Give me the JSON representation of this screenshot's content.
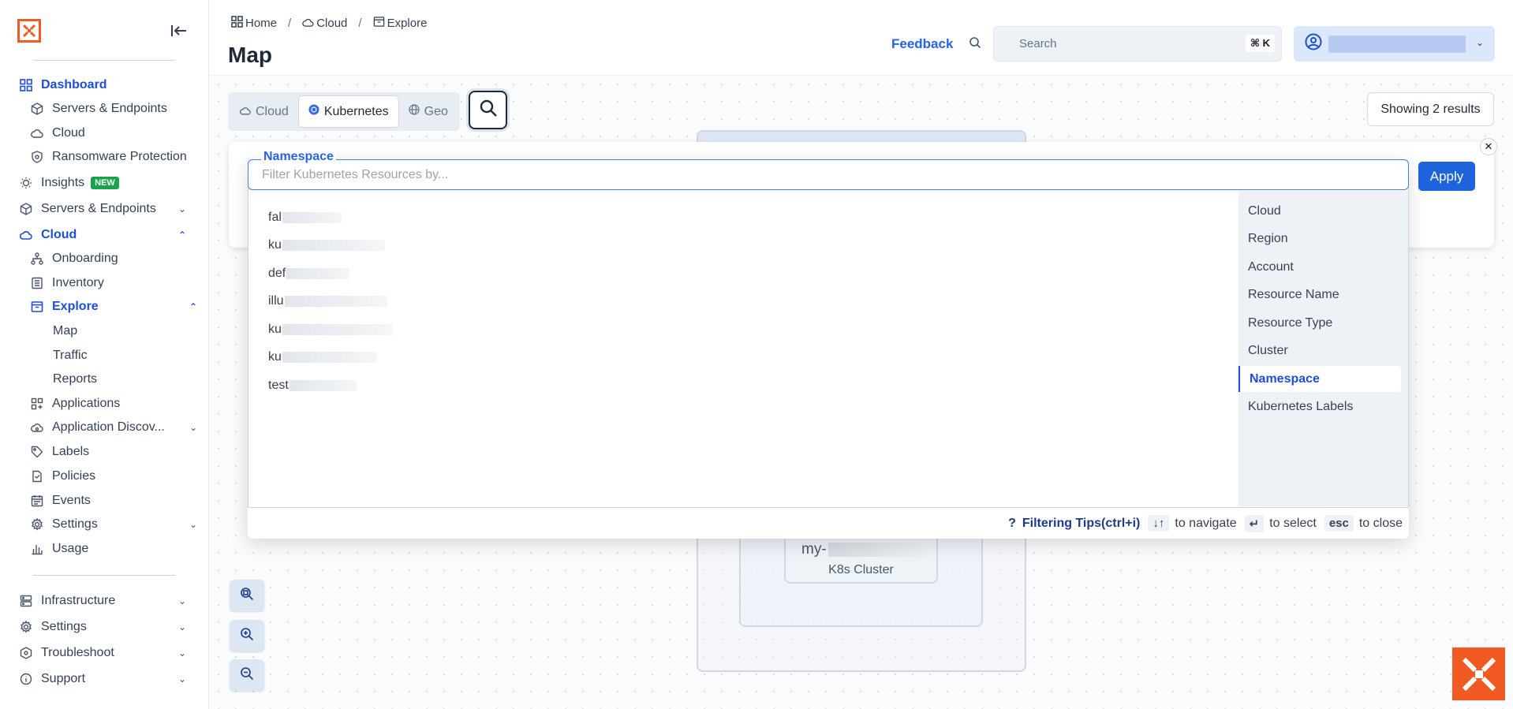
{
  "sidebar": {
    "items": [
      {
        "label": "Dashboard"
      },
      {
        "label": "Servers & Endpoints"
      },
      {
        "label": "Cloud"
      },
      {
        "label": "Ransomware Protection"
      },
      {
        "label": "Insights",
        "badge": "NEW"
      },
      {
        "label": "Servers & Endpoints"
      },
      {
        "label": "Cloud"
      },
      {
        "label": "Onboarding"
      },
      {
        "label": "Inventory"
      },
      {
        "label": "Explore"
      },
      {
        "label": "Map"
      },
      {
        "label": "Traffic"
      },
      {
        "label": "Reports"
      },
      {
        "label": "Applications"
      },
      {
        "label": "Application Discov..."
      },
      {
        "label": "Labels"
      },
      {
        "label": "Policies"
      },
      {
        "label": "Events"
      },
      {
        "label": "Settings"
      },
      {
        "label": "Usage"
      },
      {
        "label": "Infrastructure"
      },
      {
        "label": "Settings"
      },
      {
        "label": "Troubleshoot"
      },
      {
        "label": "Support"
      }
    ]
  },
  "breadcrumb": [
    "Home",
    "Cloud",
    "Explore"
  ],
  "page_title": "Map",
  "header": {
    "feedback": "Feedback",
    "search_placeholder": "Search",
    "search_shortcut": "⌘ K"
  },
  "map": {
    "tabs": [
      "Cloud",
      "Kubernetes",
      "Geo"
    ],
    "active_tab": "Kubernetes",
    "results": "Showing 2 results",
    "k8s_node": {
      "name_prefix": "my-",
      "type": "K8s Cluster"
    }
  },
  "filter": {
    "label": "Namespace",
    "placeholder": "Filter Kubernetes Resources by...",
    "apply": "Apply",
    "values": [
      {
        "prefix": "fal"
      },
      {
        "prefix": "ku"
      },
      {
        "prefix": "def"
      },
      {
        "prefix": "illu"
      },
      {
        "prefix": "ku"
      },
      {
        "prefix": "ku"
      },
      {
        "prefix": "test"
      }
    ],
    "categories": [
      "Cloud",
      "Region",
      "Account",
      "Resource Name",
      "Resource Type",
      "Cluster",
      "Namespace",
      "Kubernetes Labels"
    ],
    "active_category": "Namespace",
    "footer": {
      "tips": "Filtering Tips(ctrl+i)",
      "navigate": "to navigate",
      "select": "to select",
      "esc_key": "esc",
      "close": "to close"
    }
  },
  "colors": {
    "accent": "#1d4ed8",
    "brand": "#f15a22",
    "new_badge": "#16a34a"
  }
}
